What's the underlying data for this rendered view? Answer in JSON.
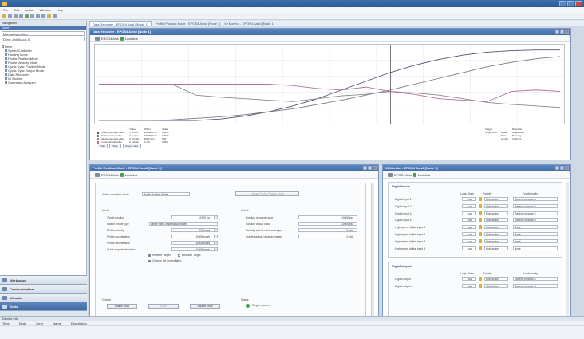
{
  "window": {
    "title": ""
  },
  "menu": [
    "File",
    "Edit",
    "Action",
    "Window",
    "Help"
  ],
  "nav": {
    "title": "Navigation",
    "header": "Drive",
    "combo1": "Manual operation",
    "combo2": "Drive: Axis0/Axis 0",
    "tree": [
      "Drive",
      "Speed Controller",
      "Homing Mode",
      "Profile Position Mode",
      "Profile Velocity Mode",
      "Cyclic Sync Position Mode",
      "Cyclic Sync Torque Mode",
      "Data Recorder",
      "IO Monitor",
      "Command Analyzer"
    ],
    "panels": [
      "Workspace",
      "Communication",
      "Wizards",
      "Tools"
    ],
    "foot": "Wizards"
  },
  "doc_tabs": [
    "Data Recorder - EPOS4 Axis0 [Node 1]",
    "Profile Position Mode - EPOS4 Axis0 [Node 1]",
    "IO Monitor - EPOS4 Axis0 [Node 1]"
  ],
  "data_recorder": {
    "title": "Data Recorder - EPOS4 Axis0 [Node 1]",
    "device": "EPOS4 Axis",
    "state": "Lockable",
    "chart_data": {
      "type": "line",
      "series": [
        {
          "color": "#5a4a70",
          "values": [
            0,
            0,
            0,
            0,
            0,
            2,
            6,
            12,
            20,
            30,
            42,
            54,
            66,
            76,
            84,
            90,
            94,
            96,
            97,
            97
          ]
        },
        {
          "color": "#7a7a7a",
          "values": [
            0,
            0,
            0,
            1,
            3,
            5,
            8,
            12,
            16,
            22,
            28,
            35,
            42,
            50,
            58,
            66,
            74,
            80,
            85,
            88
          ]
        },
        {
          "color": "#888888",
          "values": [
            50,
            50,
            50,
            50,
            35,
            32,
            30,
            28,
            26,
            30,
            34,
            36,
            40,
            38,
            35,
            30,
            25,
            22,
            20,
            18
          ]
        },
        {
          "color": "#b070a0",
          "values": [
            50,
            50,
            50,
            50,
            50,
            50,
            50,
            50,
            48,
            44,
            42,
            46,
            40,
            36,
            30,
            28,
            26,
            40,
            42,
            40
          ]
        }
      ]
    },
    "legend_header": [
      "",
      "Value",
      "Offset",
      "Scale"
    ],
    "legend": [
      {
        "name": "Position demand value",
        "color": "#5a4a70",
        "v": "0 inc/div",
        "o": "1000000 inc",
        "s": "10000"
      },
      {
        "name": "Position actual value",
        "color": "#7a7a7a",
        "v": "0 inc/div",
        "o": "1000000 inc",
        "s": "10000"
      },
      {
        "name": "Velocity demand value",
        "color": "#888888",
        "v": "0 rpm/div",
        "o": "1000 rpm",
        "s": "500"
      },
      {
        "name": "Current actual value",
        "color": "#b070a0",
        "v": "0 mA/div",
        "o": "0 mA",
        "s": "2000"
      }
    ],
    "trigger_head": [
      "Trigger",
      "Recorder"
    ],
    "trigger": [
      [
        "Single shot",
        "Mode",
        "Single shot"
      ],
      [
        "",
        "Status",
        "Running"
      ],
      [
        "",
        "Length",
        "1000 ms"
      ]
    ],
    "btn_start": "Start",
    "btn_stop": "Stop",
    "btn_export": "Export data"
  },
  "ppm": {
    "title": "Profile Position Mode - EPOS4 Axis0 [Node 1]",
    "device": "EPOS4 Axis",
    "state": "Lockable",
    "op_mode_label": "Active operation mode",
    "op_mode": "Profile Position Mode",
    "activate_btn": "Activate Profile Position Mode",
    "input_head": "Input",
    "inputs": [
      {
        "label": "Target position",
        "value": "10000 inc"
      },
      {
        "label": "Motion profile type",
        "value": "Linear ramp (trapezoidal profile)"
      },
      {
        "label": "Profile velocity",
        "value": "1000 rpm"
      },
      {
        "label": "Profile acceleration",
        "value": "10000 rpm/s"
      },
      {
        "label": "Profile deceleration",
        "value": "10000 rpm/s"
      },
      {
        "label": "Quick stop deceleration",
        "value": "10000 rpm/s"
      }
    ],
    "relative": "Relative Target",
    "absolute": "Absolute Target",
    "change_setpoint": "Change set immediately",
    "actual_head": "Actual",
    "actuals": [
      {
        "label": "Position demand value",
        "value": "10000 inc"
      },
      {
        "label": "Position actual value",
        "value": "10000 inc"
      },
      {
        "label": "Velocity actual value averaged",
        "value": "0 rpm"
      },
      {
        "label": "Current actual value averaged",
        "value": "0 mA"
      }
    ],
    "control_head": "Control",
    "btn_enable": "Enable Drive",
    "btn_move": "Move",
    "btn_halt": "Disable Drive",
    "status_head": "Status",
    "status_text": "Target reached"
  },
  "io": {
    "title": "IO Monitor - EPOS4 Axis0 [Node 1]",
    "device": "EPOS4 Axis",
    "state": "Lockable",
    "dig_inputs_head": "Digital inputs",
    "col_logic": "Logic State",
    "col_polarity": "Polarity",
    "col_func": "Functionality",
    "inputs": [
      {
        "name": "Digital input 1",
        "state": "Low",
        "pol": "High active",
        "func": "General purpose A"
      },
      {
        "name": "Digital input 2",
        "state": "Low",
        "pol": "High active",
        "func": "General purpose B"
      },
      {
        "name": "Digital input 3",
        "state": "Low",
        "pol": "High active",
        "func": "General purpose C"
      },
      {
        "name": "Digital input 4",
        "state": "Low",
        "pol": "High active",
        "func": "General purpose D"
      },
      {
        "name": "High speed digital input 1",
        "state": "Low",
        "pol": "High active",
        "func": "None"
      },
      {
        "name": "High speed digital input 2",
        "state": "Low",
        "pol": "High active",
        "func": "None"
      },
      {
        "name": "High speed digital input 3",
        "state": "Low",
        "pol": "High active",
        "func": "None"
      },
      {
        "name": "High speed digital input 4",
        "state": "Low",
        "pol": "High active",
        "func": "None"
      }
    ],
    "dig_outputs_head": "Digital outputs",
    "outputs": [
      {
        "name": "Digital output 1",
        "state": "Low",
        "pol": "High active",
        "func": "General purpose A"
      },
      {
        "name": "Digital output 2",
        "state": "Low",
        "pol": "High active",
        "func": "General purpose B"
      }
    ]
  },
  "bottom": {
    "head": "Device Info",
    "cols": [
      "Time",
      "Node",
      "Error",
      "Name",
      "Description"
    ]
  }
}
